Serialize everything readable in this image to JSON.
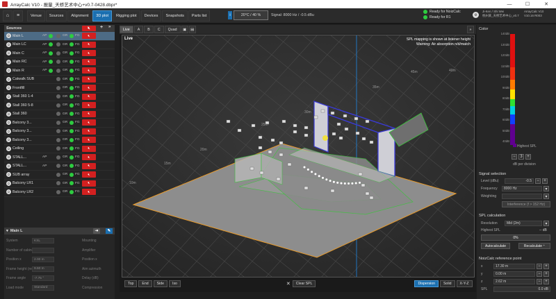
{
  "window": {
    "title": "ArrayCalc V10 - 报量_天桥艺术中心+v0.7-0428.dbpr*",
    "min": "—",
    "max": "☐",
    "close": "✕"
  },
  "menubar": {
    "home_icon": "home-icon",
    "menu_icon": "hamburger-icon",
    "tabs": [
      "Venue",
      "Sources",
      "Alignment",
      "3D plot",
      "Rigging plot",
      "Devices",
      "Snapshots",
      "Parts list"
    ],
    "active_tab": "3D plot",
    "info": "i",
    "temperature": "20°C / 40 %",
    "signal": "Signal: 8000 Hz / -0.5 dBu",
    "ready_noizcalc": "Ready for NoizCalc",
    "ready_r1": "Ready for R1",
    "user_line1": "Ji-Ken / Shi Wei",
    "user_line2": "杭州某_天桥艺术中心_v0.7",
    "version_line1": "ArrayCalc V10",
    "version_line2": "V10.16 R003"
  },
  "sources": {
    "header": "Sources",
    "add": "+",
    "expand": "»",
    "rows": [
      {
        "name": "Main L",
        "ap": "AP",
        "gr": "GR",
        "fg": "FG",
        "ap_on": true,
        "selected": true
      },
      {
        "name": "Main LC",
        "ap": "AP",
        "gr": "GR",
        "fg": "FG",
        "ap_on": true,
        "selected": false
      },
      {
        "name": "Main C",
        "ap": "AP",
        "gr": "GR",
        "fg": "FG",
        "ap_on": true,
        "selected": false
      },
      {
        "name": "Main RC",
        "ap": "AP",
        "gr": "GR",
        "fg": "FG",
        "ap_on": true,
        "selected": false
      },
      {
        "name": "Main R",
        "ap": "AP",
        "gr": "GR",
        "fg": "FG",
        "ap_on": true,
        "selected": false
      },
      {
        "name": "Catwalk SUB",
        "ap": "",
        "gr": "GR",
        "fg": "FG",
        "ap_on": false,
        "selected": false
      },
      {
        "name": "Frontfill",
        "ap": "",
        "gr": "GR",
        "fg": "FG",
        "ap_on": false,
        "selected": false
      },
      {
        "name": "Stall 360 1-4",
        "ap": "",
        "gr": "GR",
        "fg": "FG",
        "ap_on": false,
        "selected": false
      },
      {
        "name": "Stall 360 5-8",
        "ap": "",
        "gr": "GR",
        "fg": "FG",
        "ap_on": false,
        "selected": false
      },
      {
        "name": "Stall 360",
        "ap": "",
        "gr": "GR",
        "fg": "FG",
        "ap_on": false,
        "selected": false
      },
      {
        "name": "Balcony 3...",
        "ap": "",
        "gr": "GR",
        "fg": "FG",
        "ap_on": false,
        "selected": false
      },
      {
        "name": "Balcony 3...",
        "ap": "",
        "gr": "GR",
        "fg": "FG",
        "ap_on": false,
        "selected": false
      },
      {
        "name": "Balcony 3...",
        "ap": "",
        "gr": "GR",
        "fg": "FG",
        "ap_on": false,
        "selected": false
      },
      {
        "name": "Ceiling",
        "ap": "",
        "gr": "GR",
        "fg": "FG",
        "ap_on": false,
        "selected": false
      },
      {
        "name": "STALL...",
        "ap": "AP",
        "gr": "GR",
        "fg": "FG",
        "ap_on": false,
        "selected": false
      },
      {
        "name": "STALL...",
        "ap": "AP",
        "gr": "GR",
        "fg": "FG",
        "ap_on": false,
        "selected": false
      },
      {
        "name": "SUB array",
        "ap": "",
        "gr": "GR",
        "fg": "FG",
        "ap_on": false,
        "selected": false
      },
      {
        "name": "Balcony LR1",
        "ap": "",
        "gr": "GR",
        "fg": "FG",
        "ap_on": false,
        "selected": false
      },
      {
        "name": "Balcony LR2",
        "ap": "",
        "gr": "GR",
        "fg": "FG",
        "ap_on": false,
        "selected": false
      }
    ]
  },
  "props": {
    "header": "Main L",
    "rows": [
      {
        "l1": "System",
        "v1": "KSL",
        "l2": "Mounting"
      },
      {
        "l1": "Number of cabinets",
        "v1": "",
        "l2": "Amplifier"
      },
      {
        "l1": "Position x",
        "v1": "2.00 m",
        "l2": "Position x"
      },
      {
        "l1": "Frame height (ref.)",
        "v1": "9.60 m",
        "l2": "Aim azimuth"
      },
      {
        "l1": "Frame angle",
        "v1": "-7.75 °",
        "l2": "Delay (dB)"
      },
      {
        "l1": "Load mode",
        "v1": "Standard",
        "l2": "Compression"
      }
    ]
  },
  "viewport": {
    "tabs": [
      "Live",
      "A",
      "B",
      "C",
      "Quad"
    ],
    "active_tab": "Live",
    "expand": "»",
    "live_label": "Live",
    "note_line1": "SPL mapping is shown at listener height",
    "note_line2": "Warning: Air absorption n/d/match",
    "grid_labels": [
      "45m",
      "40m",
      "35m",
      "30m",
      "25m",
      "20m",
      "15m",
      "10m",
      "5m"
    ],
    "bottom": {
      "views": [
        "Top",
        "End",
        "Side",
        "Iso"
      ],
      "clear": "Clear SPL",
      "modes": [
        "Dispersion",
        "Solid",
        "X-Y-Z"
      ],
      "active_mode": "Dispersion"
    }
  },
  "color": {
    "header": "Color",
    "ticks": [
      "140dB",
      "130dB",
      "120dB",
      "110dB",
      "100dB",
      "90dB",
      "80dB",
      "70dB",
      "60dB",
      "50dB",
      "40dB"
    ],
    "highest": "Highest SPL",
    "db_value": "3",
    "db_label": "dB per division"
  },
  "signal_sel": {
    "header": "Signal selection",
    "level_label": "Level (dBu)",
    "level_value": "-0.5",
    "freq_label": "Frequency",
    "freq_value": "8000 Hz",
    "weight_label": "Weighting",
    "weight_value": "",
    "interference": "Interference (f > 152 Hz)"
  },
  "spl_calc": {
    "header": "SPL calculation",
    "resolution_label": "Resolution",
    "resolution_value": "Mid (2m)",
    "highest_label": "Highest SPL",
    "highest_value": "-- dB",
    "progress": "0%",
    "autocalc": "Autocalculate",
    "recalc": "Recalculate ⁺"
  },
  "noiz": {
    "header": "NoizCalc reference point",
    "x_label": "x",
    "x_value": "17.30 m",
    "y_label": "y",
    "y_value": "0.00 m",
    "z_label": "z",
    "z_value": "2.62 m",
    "spl_label": "SPL",
    "spl_value": "0.0 dB"
  },
  "colors": {
    "accent": "#1b6fb0",
    "mute_red": "#d32020",
    "ready_green": "#2ecc40",
    "floor_orange": "#e89a2a",
    "wall_blue": "#3a3ad6",
    "spl_green": "#39c639"
  }
}
